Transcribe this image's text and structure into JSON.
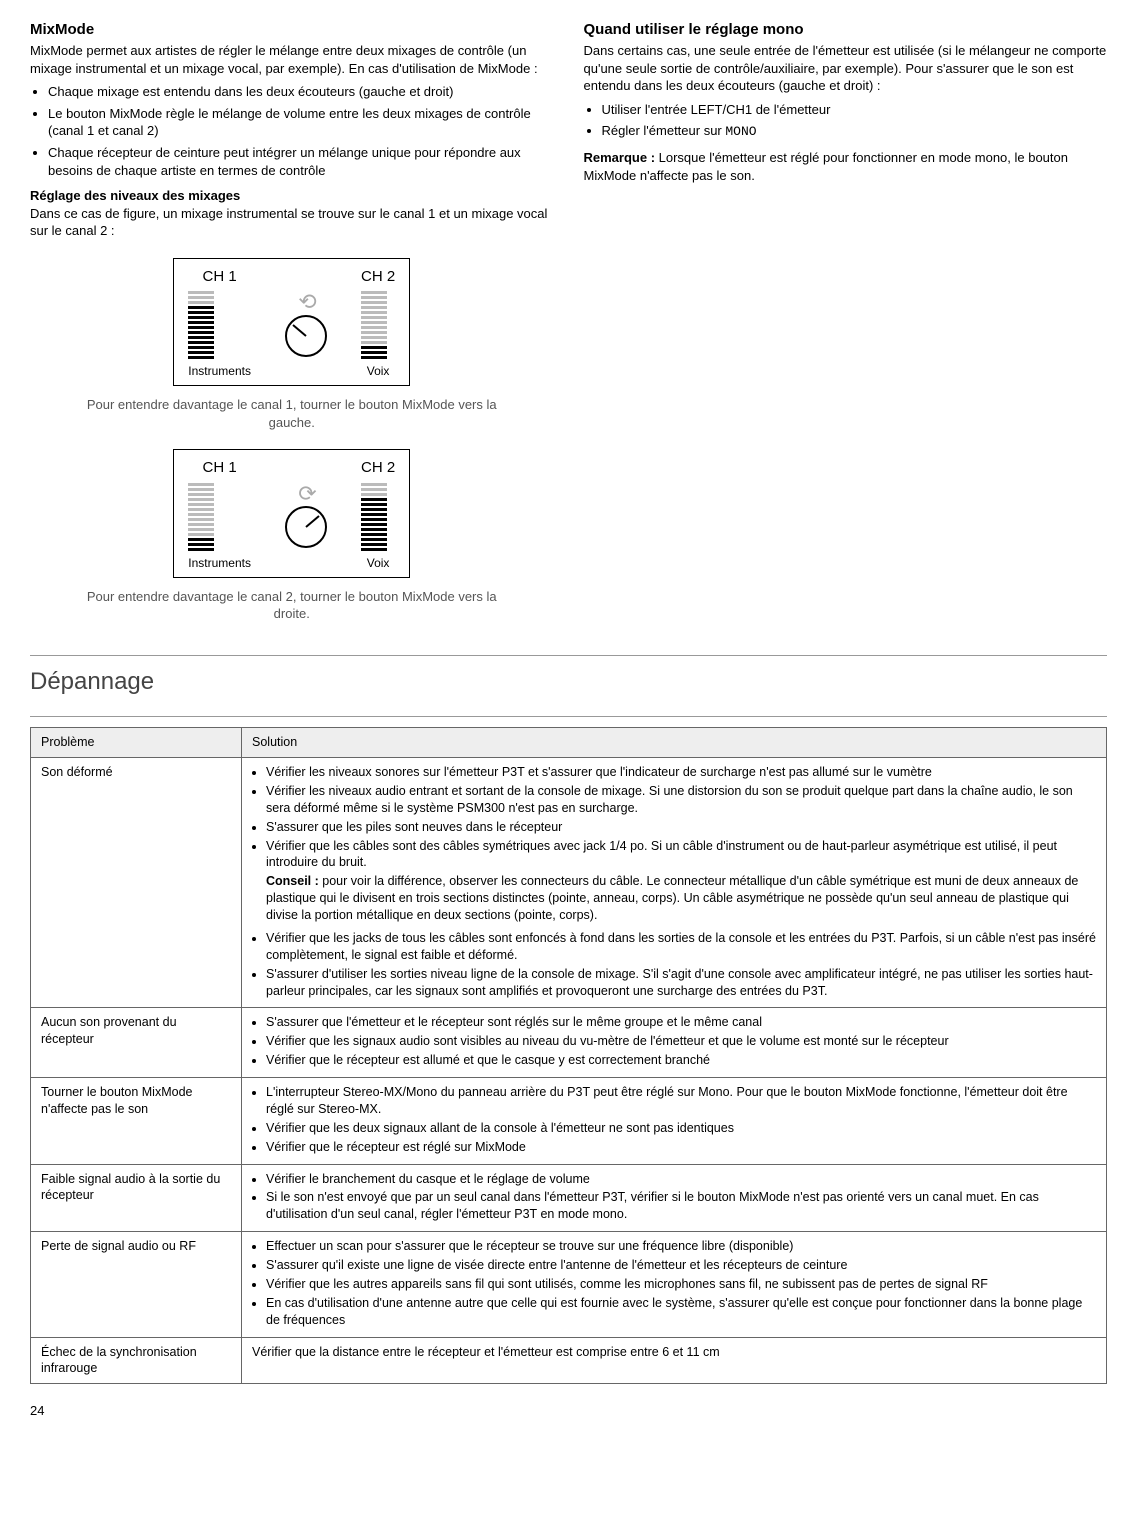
{
  "left": {
    "h": "MixMode",
    "p1": "MixMode permet aux artistes de régler le mélange entre deux mixages de contrôle (un mixage instrumental et un mixage vocal, par exemple). En cas d'utilisation de MixMode :",
    "b1": "Chaque mixage est entendu dans les deux écouteurs (gauche et droit)",
    "b2": "Le bouton MixMode règle le mélange de volume entre les deux mixages de contrôle (canal 1 et canal 2)",
    "b3": "Chaque récepteur de ceinture peut intégrer un mélange unique pour répondre aux besoins de chaque artiste en termes de contrôle",
    "h2": "Réglage des niveaux des mixages",
    "p2": "Dans ce cas de figure, un mixage instrumental se trouve sur le canal 1 et un mixage vocal sur le canal 2 :",
    "cap1": "Pour entendre davantage le canal 1, tourner le bouton MixMode vers la gauche.",
    "cap2": "Pour entendre davantage le canal 2, tourner le bouton MixMode vers la droite."
  },
  "right": {
    "h": "Quand utiliser le réglage mono",
    "p1": "Dans certains cas, une seule entrée de l'émetteur est utilisée (si le mélangeur ne comporte qu'une seule sortie de contrôle/auxiliaire, par exemple). Pour s'assurer que le son est entendu dans les deux écouteurs (gauche et droit) :",
    "b1": "Utiliser l'entrée LEFT/CH1 de l'émetteur",
    "b2a": "Régler l'émetteur sur ",
    "b2b": "MONO",
    "noteL": "Remarque : ",
    "note": "Lorsque l'émetteur est réglé pour fonctionner en mode mono, le bouton MixMode n'affecte pas le son."
  },
  "diag": {
    "ch1": "CH 1",
    "ch2": "CH 2",
    "instr": "Instruments",
    "voix": "Voix"
  },
  "depan": "Dépannage",
  "th1": "Problème",
  "th2": "Solution",
  "rows": [
    {
      "p": "Son déformé",
      "items": [
        "Vérifier les niveaux sonores sur l'émetteur P3T et s'assurer que l'indicateur de surcharge n'est pas allumé sur le vumètre",
        "Vérifier les niveaux audio entrant et sortant de la console de mixage. Si une distorsion du son se produit quelque part dans la chaîne audio, le son sera déformé même si le système PSM300 n'est pas en surcharge.",
        "S'assurer que les piles sont neuves dans le récepteur",
        "Vérifier que les câbles sont des câbles symétriques avec jack 1/4 po. Si un câble d'instrument ou de haut-parleur asymétrique est utilisé, il peut introduire du bruit."
      ],
      "tipL": "Conseil : ",
      "tip": "pour voir la différence, observer les connecteurs du câble. Le connecteur métallique d'un câble symétrique est muni de deux anneaux de plastique qui le divisent en trois sections distinctes (pointe, anneau, corps). Un câble asymétrique ne possède qu'un seul anneau de plastique qui divise la portion métallique en deux sections (pointe, corps).",
      "items2": [
        "Vérifier que les jacks de tous les câbles sont enfoncés à fond dans les sorties de la console et les entrées du P3T. Parfois, si un câble n'est pas inséré complètement, le signal est faible et déformé.",
        "S'assurer d'utiliser les sorties niveau ligne de la console de mixage. S'il s'agit d'une console avec amplificateur intégré, ne pas utiliser les sorties haut-parleur principales, car les signaux sont amplifiés et provoqueront une surcharge des entrées du P3T."
      ]
    },
    {
      "p": "Aucun son provenant du récepteur",
      "items": [
        "S'assurer que l'émetteur et le récepteur sont réglés sur le même groupe et le même canal",
        "Vérifier que les signaux audio sont visibles au niveau du vu-mètre de l'émetteur et que le volume est monté sur le récepteur",
        "Vérifier que le récepteur est allumé et que le casque y est correctement branché"
      ]
    },
    {
      "p": "Tourner le bouton MixMode n'affecte pas le son",
      "items": [
        "L'interrupteur Stereo-MX/Mono du panneau arrière du P3T peut être réglé sur Mono. Pour que le bouton MixMode fonctionne, l'émetteur doit être réglé sur Stereo-MX.",
        "Vérifier que les deux signaux allant de la console à l'émetteur ne sont pas identiques",
        "Vérifier que le récepteur est réglé sur MixMode"
      ]
    },
    {
      "p": "Faible signal audio à la sortie du récepteur",
      "items": [
        "Vérifier le branchement du casque et le réglage de volume",
        "Si le son n'est envoyé que par un seul canal dans l'émetteur P3T, vérifier si le bouton MixMode n'est pas orienté vers un canal muet. En cas d'utilisation d'un seul canal, régler l'émetteur P3T en mode mono."
      ]
    },
    {
      "p": "Perte de signal audio ou RF",
      "items": [
        "Effectuer un scan pour s'assurer que le récepteur se trouve sur une fréquence libre (disponible)",
        "S'assurer qu'il existe une ligne de visée directe entre l'antenne de l'émetteur et les récepteurs de ceinture",
        "Vérifier que les autres appareils sans fil qui sont utilisés, comme les microphones sans fil, ne subissent pas de pertes de signal RF",
        "En cas d'utilisation d'une antenne autre que celle qui est fournie avec le système, s'assurer qu'elle est conçue pour fonctionner dans la bonne plage de fréquences"
      ]
    },
    {
      "p": "Échec de la synchronisation infrarouge",
      "plain": "Vérifier que la distance entre le récepteur et l'émetteur est comprise entre 6 et 11 cm"
    }
  ],
  "page": "24"
}
